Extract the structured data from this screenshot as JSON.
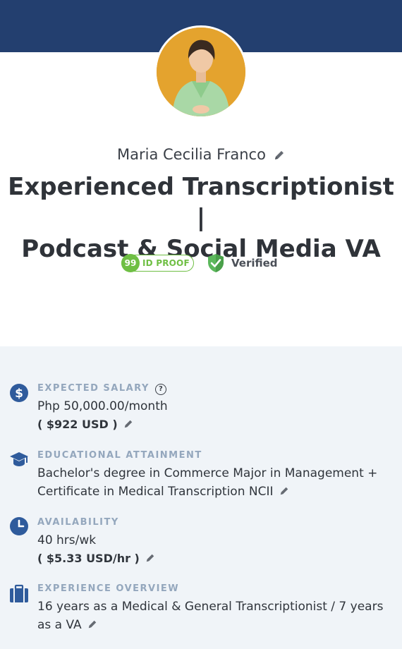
{
  "profile": {
    "name": "Maria Cecilia Franco",
    "headline_line1": "Experienced Transcriptionist |",
    "headline_line2": "Podcast & Social Media VA"
  },
  "badges": {
    "id_proof_score": "99",
    "id_proof_label": "ID PROOF",
    "verified_label": "Verified"
  },
  "details": {
    "salary": {
      "label": "EXPECTED SALARY",
      "value": "Php 50,000.00/month",
      "sub": "( $922 USD )",
      "help": "?"
    },
    "education": {
      "label": "EDUCATIONAL ATTAINMENT",
      "value": "Bachelor's degree in Commerce Major in Management + Certificate in Medical Transcription NCII"
    },
    "availability": {
      "label": "AVAILABILITY",
      "value": "40 hrs/wk",
      "sub": "( $5.33 USD/hr )"
    },
    "experience": {
      "label": "EXPERIENCE OVERVIEW",
      "value": "16 years as a Medical & General Transcriptionist / 7 years as a VA"
    }
  },
  "colors": {
    "banner": "#233f6f",
    "accent_green": "#6fbf44",
    "icon_blue": "#2f5b9c",
    "details_bg": "#f0f4f8"
  },
  "icons": [
    "pencil-icon",
    "question-icon",
    "shield-check-icon",
    "dollar-icon",
    "graduation-cap-icon",
    "clock-icon",
    "briefcase-icon"
  ]
}
